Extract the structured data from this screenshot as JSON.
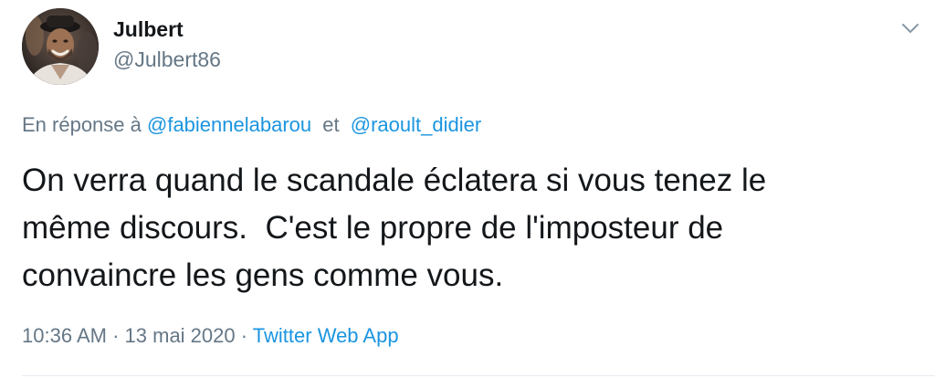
{
  "author": {
    "display_name": "Julbert",
    "handle": "@Julbert86",
    "avatar_icon": "user-avatar-photo"
  },
  "menu": {
    "caret_icon": "chevron-down-icon"
  },
  "reply": {
    "prefix": "En réponse à",
    "mention_1": "@fabiennelabarou",
    "joiner": "et",
    "mention_2": "@raoult_didier"
  },
  "tweet": {
    "line_1": "On verra quand le scandale éclatera si vous tenez le",
    "line_2": "même discours.  C'est le propre de l'imposteur de",
    "line_3": "convaincre les gens comme vous."
  },
  "meta": {
    "time": "10:36 AM",
    "separator": "·",
    "date": "13 mai 2020",
    "source": "Twitter Web App"
  },
  "colors": {
    "text": "#14171a",
    "secondary": "#657786",
    "link": "#1b95e0",
    "divider": "#e6ecf0"
  }
}
